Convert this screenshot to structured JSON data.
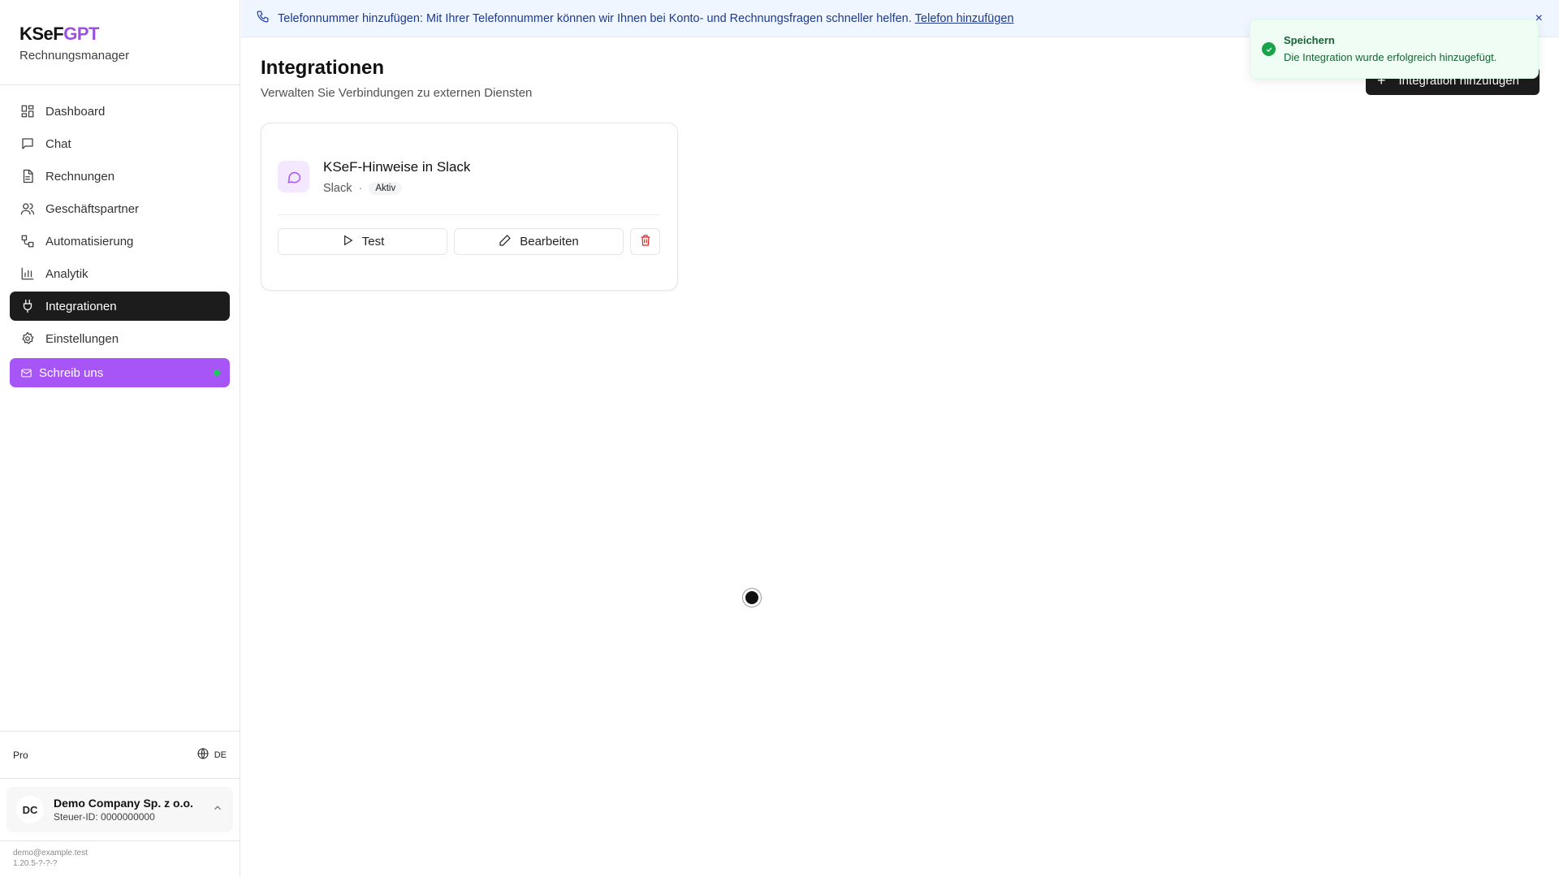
{
  "brand": {
    "logo_part1": "KSeF",
    "logo_part2": "GPT",
    "subtitle": "Rechnungsmanager"
  },
  "sidebar": {
    "items": [
      {
        "label": "Dashboard",
        "icon": "dashboard-icon"
      },
      {
        "label": "Chat",
        "icon": "chat-icon"
      },
      {
        "label": "Rechnungen",
        "icon": "document-icon"
      },
      {
        "label": "Geschäftspartner",
        "icon": "users-icon"
      },
      {
        "label": "Automatisierung",
        "icon": "workflow-icon"
      },
      {
        "label": "Analytik",
        "icon": "bar-chart-icon"
      },
      {
        "label": "Integrationen",
        "icon": "plug-icon",
        "active": true
      },
      {
        "label": "Einstellungen",
        "icon": "gear-icon"
      }
    ],
    "write_us": "Schreib uns",
    "plan": "Pro",
    "language": "DE",
    "company": {
      "initials": "DC",
      "name": "Demo Company Sp. z o.o.",
      "tax_id": "Steuer-ID: 0000000000"
    },
    "user_email": "demo@example.test",
    "version": "1.20.5-?-?-?"
  },
  "banner": {
    "text": "Telefonnummer hinzufügen: Mit Ihrer Telefonnummer können wir Ihnen bei Konto- und Rechnungsfragen schneller helfen.",
    "link": "Telefon hinzufügen",
    "close": "×"
  },
  "page": {
    "title": "Integrationen",
    "subtitle": "Verwalten Sie Verbindungen zu externen Diensten",
    "add_button": "Integration hinzufügen"
  },
  "integration": {
    "name": "KSeF-Hinweise in Slack",
    "type": "Slack",
    "separator": "·",
    "status": "Aktiv",
    "test_label": "Test",
    "edit_label": "Bearbeiten"
  },
  "toast": {
    "title": "Speichern",
    "message": "Die Integration wurde erfolgreich hinzugefügt."
  },
  "colors": {
    "accent": "#a855f7",
    "active_nav": "#1c1c1c",
    "success": "#16a34a"
  }
}
